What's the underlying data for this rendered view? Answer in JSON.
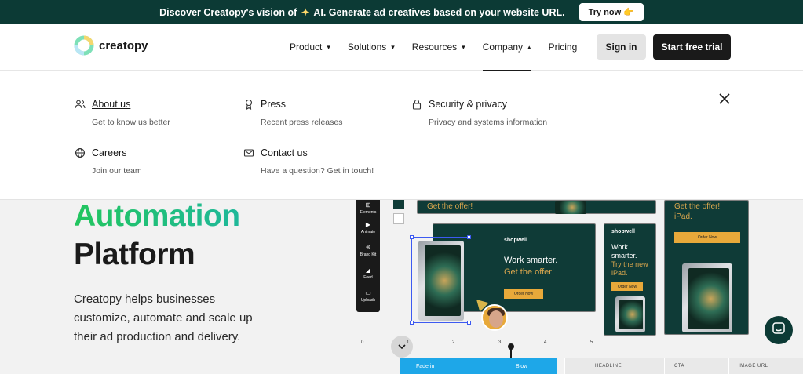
{
  "announcement": {
    "text_before": "Discover Creatopy's vision of",
    "sparkle": "✦",
    "text_after": "AI. Generate ad creatives based on your website URL.",
    "button": "Try now 👉"
  },
  "header": {
    "logo_text": "creatopy",
    "nav": [
      {
        "label": "Product",
        "chevron": "▾"
      },
      {
        "label": "Solutions",
        "chevron": "▾"
      },
      {
        "label": "Resources",
        "chevron": "▾"
      },
      {
        "label": "Company",
        "chevron": "▴"
      },
      {
        "label": "Pricing",
        "chevron": ""
      }
    ],
    "sign_in": "Sign in",
    "start_trial": "Start free trial"
  },
  "dropdown": {
    "items": [
      {
        "title": "About us",
        "subtitle": "Get to know us better",
        "icon": "people-icon"
      },
      {
        "title": "Press",
        "subtitle": "Recent press releases",
        "icon": "award-icon"
      },
      {
        "title": "Security & privacy",
        "subtitle": "Privacy and systems information",
        "icon": "lock-icon"
      },
      {
        "title": "Careers",
        "subtitle": "Join our team",
        "icon": "globe-icon"
      },
      {
        "title": "Contact us",
        "subtitle": "Have a question? Get in touch!",
        "icon": "mail-icon"
      }
    ]
  },
  "hero": {
    "line1": "Automation",
    "line2": "Platform",
    "paragraph": "Creatopy helps businesses customize, automate and scale up their ad production and delivery."
  },
  "editor": {
    "tools": [
      "Elements",
      "Animate",
      "Brand Kit",
      "Feed",
      "Uploads"
    ],
    "brand": "shopwell",
    "headline": "Work smarter.",
    "headline_tall": "Work smarter.",
    "subline": "Get the offer!",
    "subline_2": "Try the new iPad.",
    "cta": "Order Now",
    "ruler": [
      "0",
      "1",
      "2",
      "3",
      "4",
      "5"
    ],
    "tracks": [
      "Fade in",
      "Blow"
    ],
    "columns": [
      "HEADLINE",
      "CTA",
      "IMAGE URL"
    ]
  },
  "colors": {
    "brand_dark": "#0c3a35",
    "accent_green": "#22c55e",
    "accent_teal": "#1fb89a",
    "cta_orange": "#e8a93a",
    "timeline_blue": "#1ea7e8"
  }
}
